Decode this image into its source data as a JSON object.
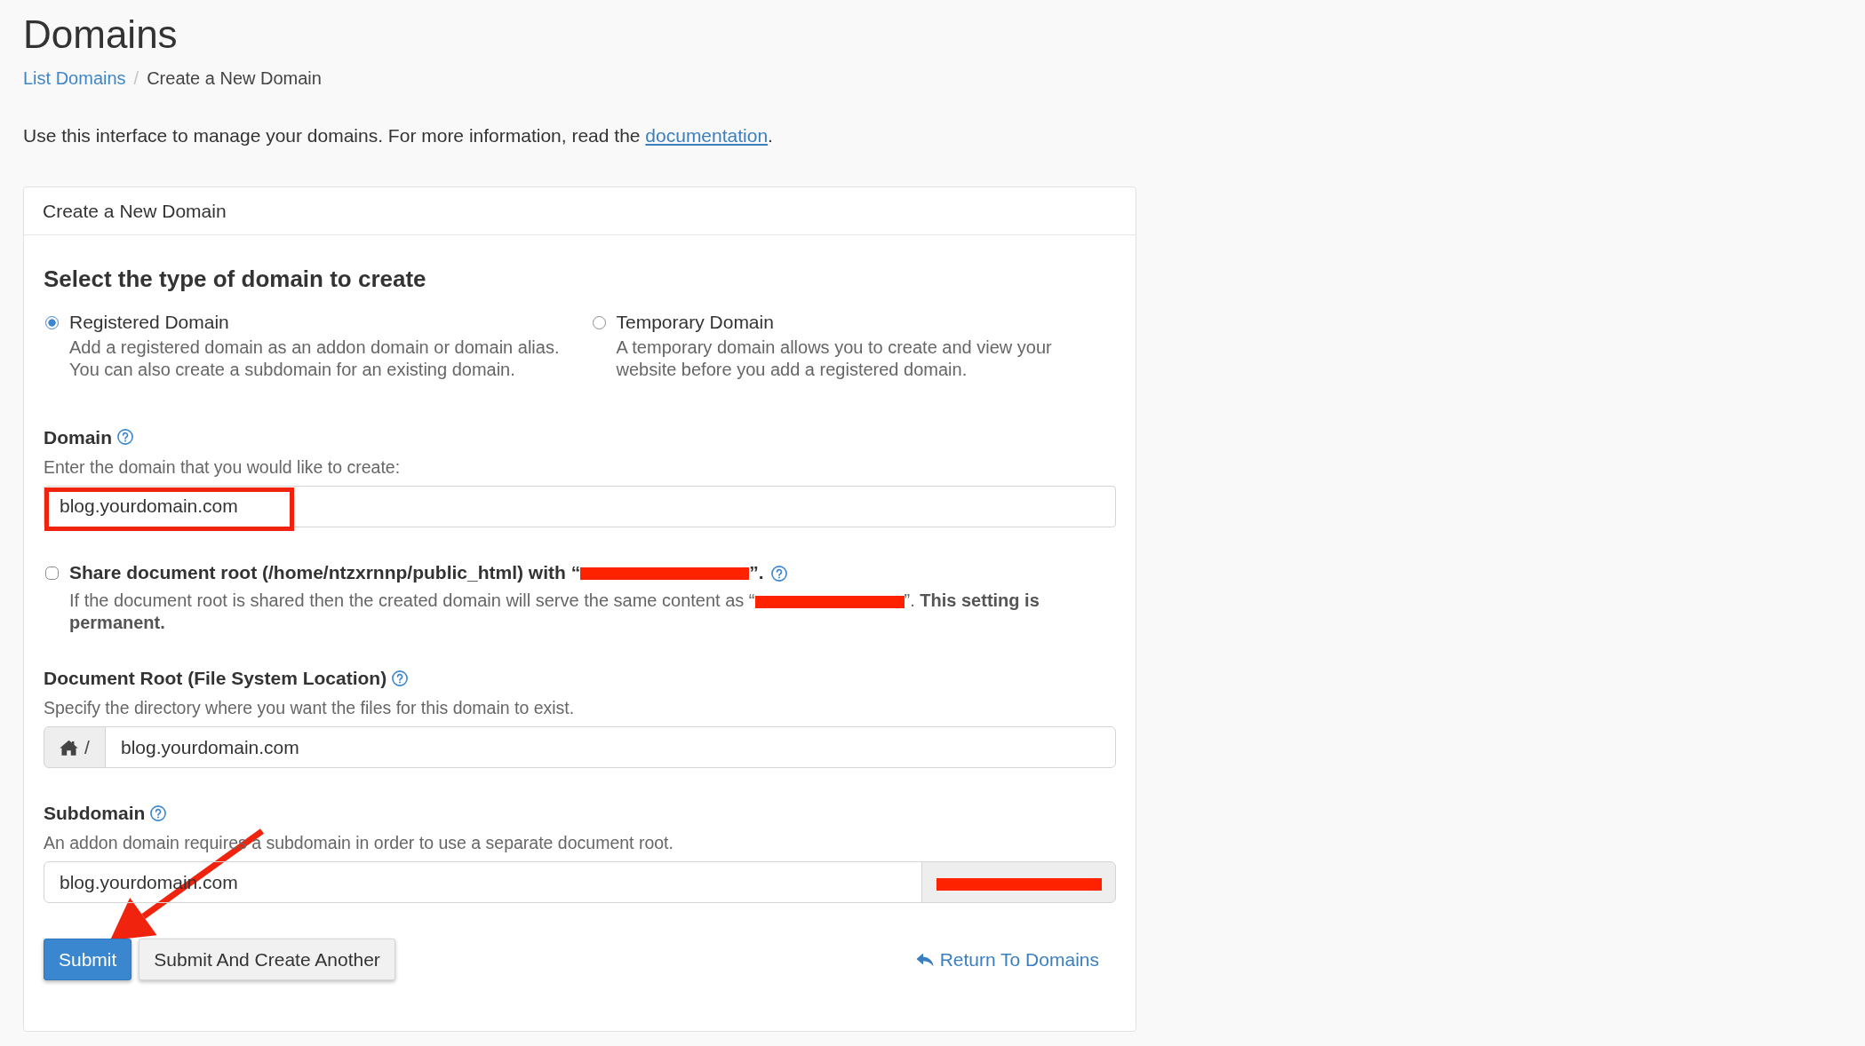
{
  "header": {
    "title": "Domains",
    "breadcrumb": {
      "items": [
        {
          "label": "List Domains",
          "kind": "link"
        },
        {
          "label": "Create a New Domain",
          "kind": "current"
        }
      ],
      "separator": "/"
    }
  },
  "intro": {
    "text": "Use this interface to manage your domains. For more information, read the ",
    "link": "documentation",
    "end": "."
  },
  "card": {
    "title": "Create a New Domain"
  },
  "domain_type": {
    "heading": "Select the type of domain to create",
    "options": [
      {
        "label": "Registered Domain",
        "description": "Add a registered domain as an addon domain or domain alias. You can also create a subdomain for an existing domain.",
        "selected": true
      },
      {
        "label": "Temporary Domain",
        "description": "A temporary domain allows you to create and view your website before you add a registered domain.",
        "selected": false
      }
    ]
  },
  "fields": [
    {
      "kind": "text",
      "label": "Domain",
      "hint": "Enter the domain that you would like to create:",
      "value": "blog.yourdomain.com",
      "highlighted": true
    },
    {
      "kind": "checkbox",
      "checked": false,
      "label_parts": [
        {
          "kind": "text",
          "text": "Share document root (/home/ntzxrnnp/public_html) with “"
        },
        {
          "kind": "redacted"
        },
        {
          "kind": "text",
          "text": "”."
        }
      ],
      "help_parts": [
        {
          "kind": "text",
          "text": "If the document root is shared then the created domain will serve the same content as “"
        },
        {
          "kind": "redacted"
        },
        {
          "kind": "text",
          "text": "”. **This setting is permanent.**"
        }
      ]
    },
    {
      "kind": "prefixed",
      "label": "Document Root (File System Location)",
      "hint": "Specify the directory where you want the files for this domain to exist.",
      "prefix": "/",
      "value": "blog.yourdomain.com"
    },
    {
      "kind": "suffixed",
      "label": "Subdomain",
      "hint": "An addon domain requires a subdomain in order to use a separate document root.",
      "value": "blog.yourdomain.com",
      "suffix_redacted": true
    }
  ],
  "actions": {
    "buttons": [
      {
        "label": "Submit",
        "kind": "primary",
        "arrow_pointer": true
      },
      {
        "label": "Submit And Create Another",
        "kind": "secondary"
      }
    ],
    "return_link": "Return To Domains"
  }
}
